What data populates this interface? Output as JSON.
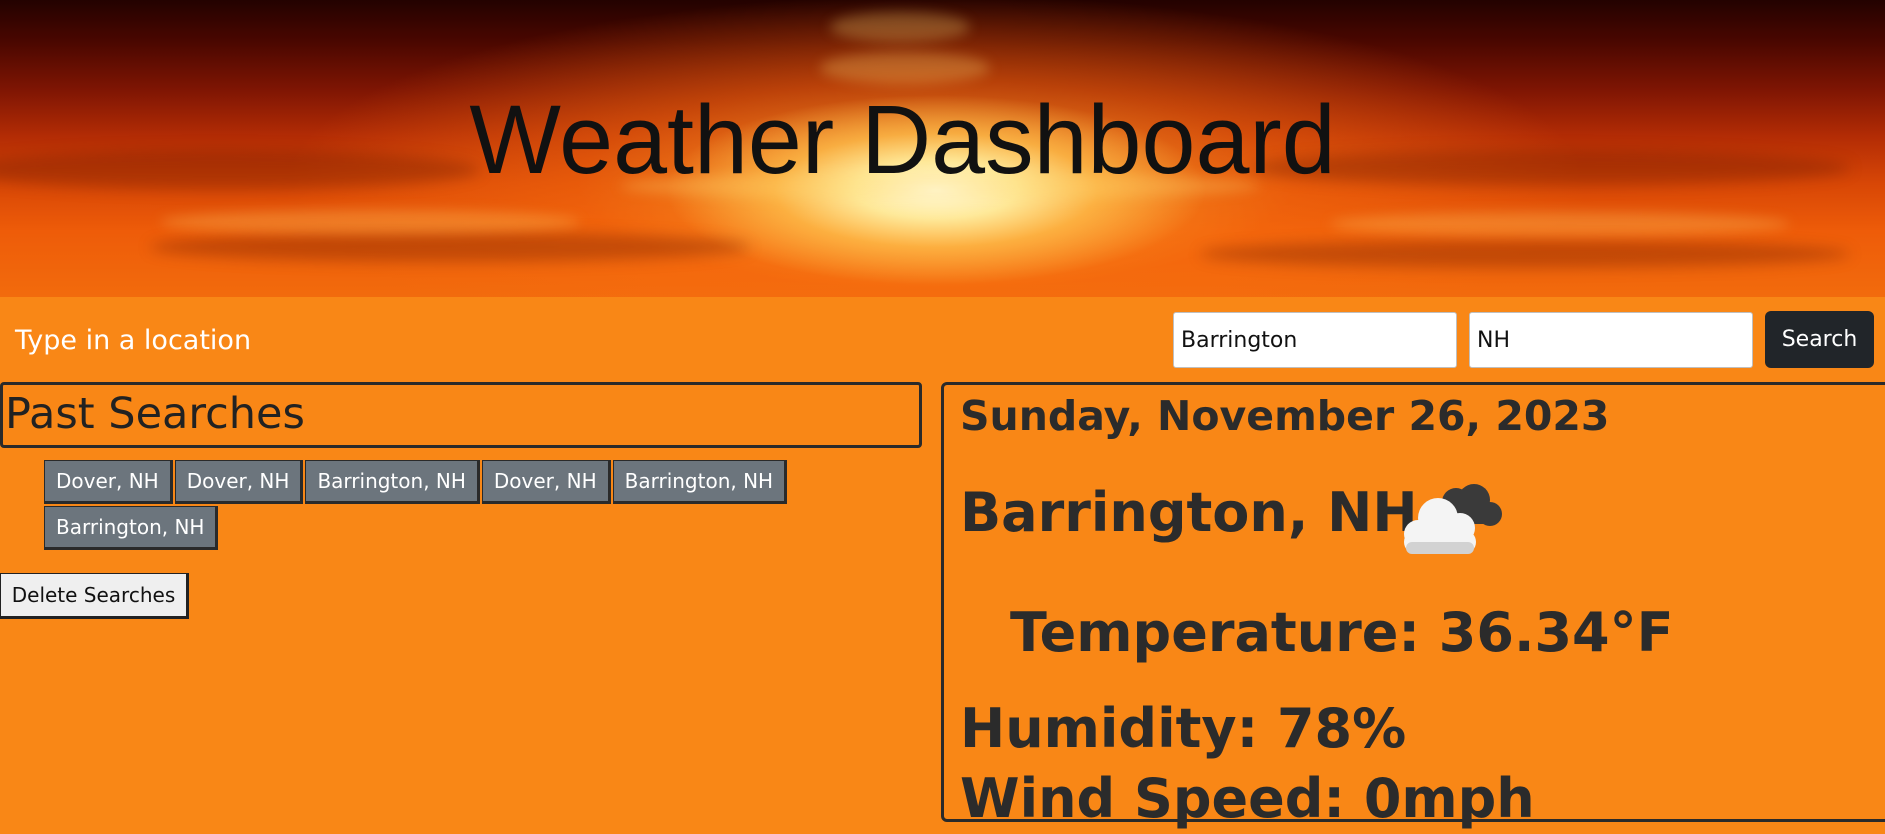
{
  "header": {
    "title": "Weather Dashboard"
  },
  "search": {
    "label": "Type in a location",
    "city_value": "Barrington",
    "state_value": "NH",
    "button_label": "Search"
  },
  "past_searches": {
    "title": "Past Searches",
    "items": [
      "Dover, NH",
      "Dover, NH",
      "Barrington, NH",
      "Dover, NH",
      "Barrington, NH",
      "Barrington, NH"
    ],
    "delete_label": "Delete Searches"
  },
  "current": {
    "date": "Sunday, November 26, 2023",
    "city": "Barrington, NH",
    "icon": "cloudy-icon",
    "temperature": "Temperature: 36.34°F",
    "humidity": "Humidity: 78%",
    "wind": "Wind Speed: 0mph"
  },
  "colors": {
    "background": "#f98716",
    "button_dark": "#212529",
    "history_button": "#6c757d"
  }
}
